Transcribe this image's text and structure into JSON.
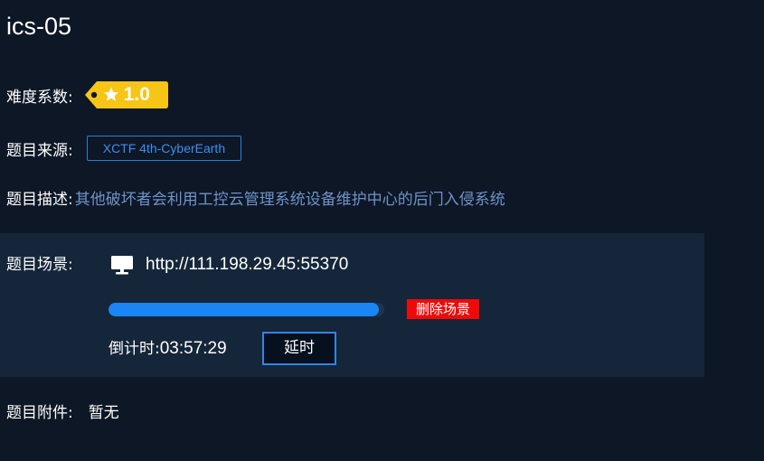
{
  "challenge": {
    "title": "ics-05"
  },
  "difficulty": {
    "label": "难度系数:",
    "value": "1.0",
    "badge_color": "#f7c516"
  },
  "source": {
    "label": "题目来源:",
    "value": "XCTF 4th-CyberEarth"
  },
  "description": {
    "label": "题目描述:",
    "value": "其他破坏者会利用工控云管理系统设备维护中心的后门入侵系统"
  },
  "scene": {
    "label": "题目场景:",
    "icon": "monitor-icon",
    "url": "http://111.198.29.45:55370",
    "progress": 0.98,
    "delete_label": "删除场景",
    "countdown_label": "倒计时:",
    "countdown_value": "03:57:29",
    "extend_label": "延时"
  },
  "attachment": {
    "label": "题目附件:",
    "value": "暂无"
  }
}
